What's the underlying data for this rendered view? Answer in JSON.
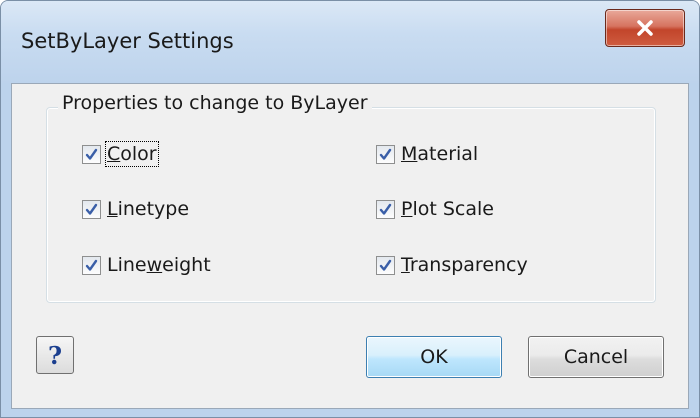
{
  "window": {
    "title": "SetByLayer Settings"
  },
  "group": {
    "legend": "Properties to change to ByLayer"
  },
  "checkboxes": [
    {
      "label_pre": "",
      "label_ul": "C",
      "label_post": "olor",
      "checked": true
    },
    {
      "label_pre": "",
      "label_ul": "L",
      "label_post": "inetype",
      "checked": true
    },
    {
      "label_pre": "Line",
      "label_ul": "w",
      "label_post": "eight",
      "checked": true
    },
    {
      "label_pre": "",
      "label_ul": "M",
      "label_post": "aterial",
      "checked": true
    },
    {
      "label_pre": "",
      "label_ul": "P",
      "label_post": "lot Scale",
      "checked": true
    },
    {
      "label_pre": "",
      "label_ul": "T",
      "label_post": "ransparency",
      "checked": true
    }
  ],
  "buttons": {
    "help": "?",
    "ok": "OK",
    "cancel": "Cancel"
  },
  "icons": {
    "close": "close-icon",
    "check": "checkmark-icon"
  },
  "colors": {
    "close_button": "#c2452b",
    "title_bar": "#c9dcf1",
    "check_mark": "#3a5fa8",
    "help_glyph": "#1b3f8f"
  }
}
